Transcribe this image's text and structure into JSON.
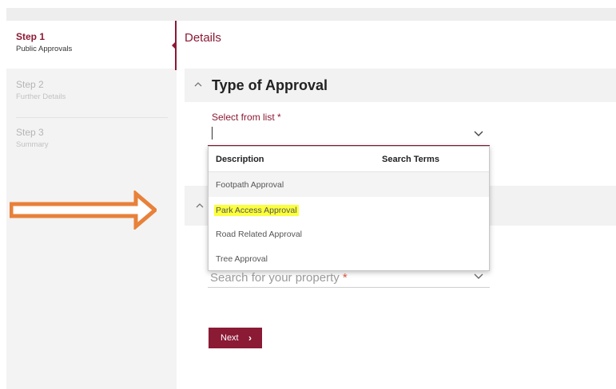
{
  "steps": [
    {
      "title": "Step 1",
      "subtitle": "Public Approvals",
      "state": "active"
    },
    {
      "title": "Step 2",
      "subtitle": "Further Details",
      "state": "inactive"
    },
    {
      "title": "Step 3",
      "subtitle": "Summary",
      "state": "inactive"
    }
  ],
  "main": {
    "title": "Details",
    "section": {
      "title": "Type of Approval"
    },
    "select_field": {
      "label": "Select from list",
      "required_mark": "*",
      "value": ""
    },
    "dropdown": {
      "columns": [
        "Description",
        "Search Terms"
      ],
      "options": [
        {
          "label": "Footpath Approval",
          "state": "hovered"
        },
        {
          "label": "Park Access Approval",
          "state": "highlighted"
        },
        {
          "label": "Road Related Approval",
          "state": "normal"
        },
        {
          "label": "Tree Approval",
          "state": "normal"
        }
      ]
    },
    "property_search": {
      "placeholder": "Search for your property",
      "required_mark": "*"
    },
    "next_button": {
      "label": "Next",
      "icon": "chevron-right-icon"
    }
  },
  "annotation": {
    "icon": "orange-arrow-icon",
    "color": "#e8813a"
  },
  "colors": {
    "accent": "#8b1a35",
    "highlight": "#fbff3c",
    "sidebar_bg": "#f3f3f3"
  }
}
